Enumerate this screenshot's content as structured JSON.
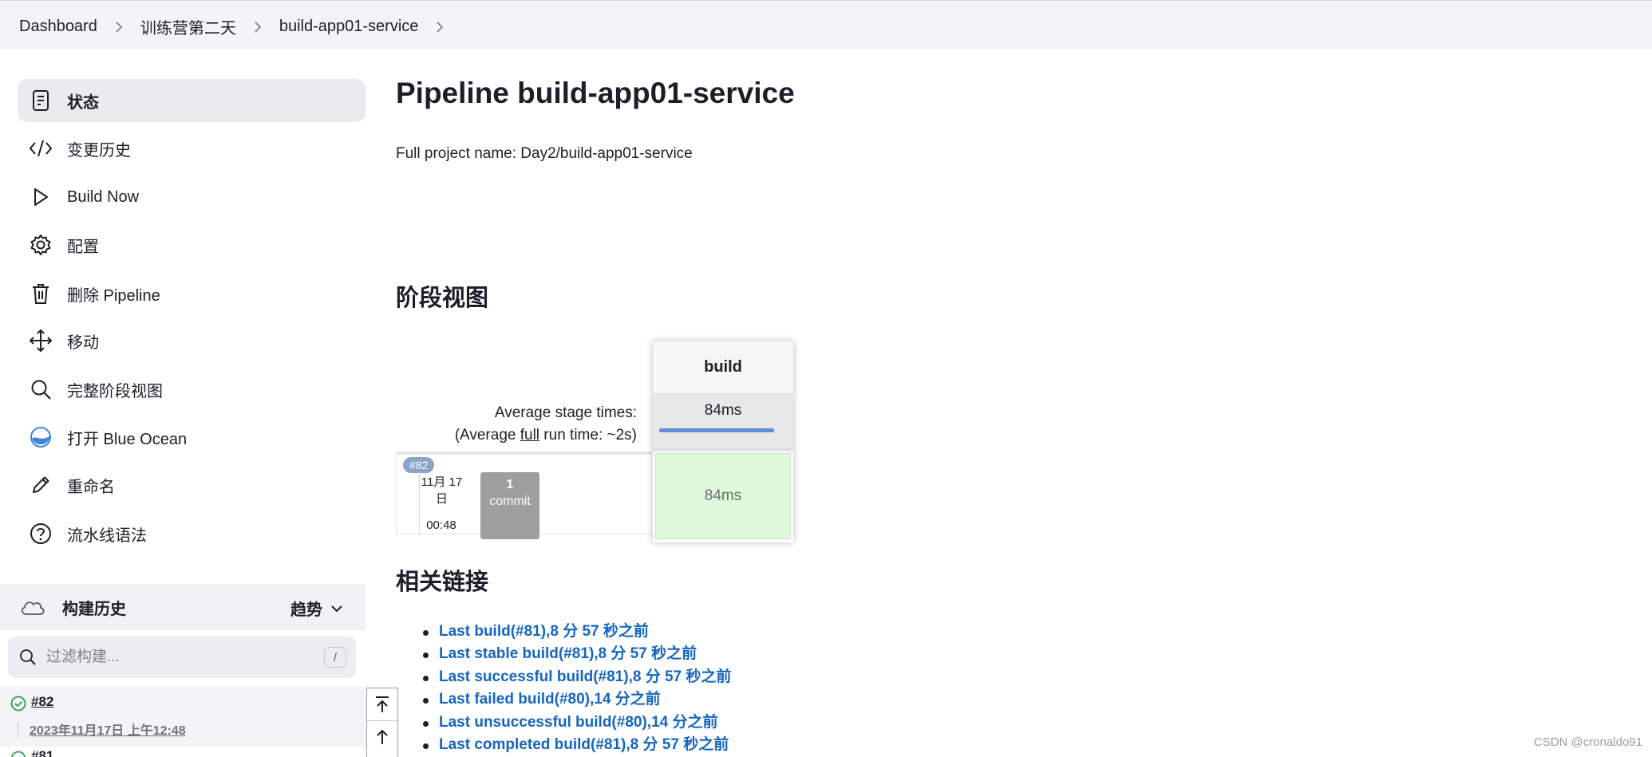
{
  "breadcrumb": [
    "Dashboard",
    "训练营第二天",
    "build-app01-service"
  ],
  "sidebar": {
    "items": [
      {
        "label": "状态",
        "icon": "status-icon",
        "active": true
      },
      {
        "label": "变更历史",
        "icon": "code-icon"
      },
      {
        "label": "Build Now",
        "icon": "play-icon"
      },
      {
        "label": "配置",
        "icon": "gear-icon"
      },
      {
        "label": "删除 Pipeline",
        "icon": "trash-icon"
      },
      {
        "label": "移动",
        "icon": "move-icon"
      },
      {
        "label": "完整阶段视图",
        "icon": "search-icon"
      },
      {
        "label": "打开 Blue Ocean",
        "icon": "blue-ocean-icon"
      },
      {
        "label": "重命名",
        "icon": "pencil-icon"
      },
      {
        "label": "流水线语法",
        "icon": "help-icon"
      }
    ]
  },
  "build_history": {
    "title": "构建历史",
    "trend_label": "趋势",
    "filter_placeholder": "过滤构建...",
    "shortcut_key": "/",
    "builds": [
      {
        "number": "#82",
        "date": "2023年11月17日 上午12:48",
        "status": "success"
      },
      {
        "number": "#81",
        "status": "success"
      }
    ]
  },
  "main": {
    "title": "Pipeline build-app01-service",
    "full_name": "Full project name: Day2/build-app01-service",
    "stage_view_title": "阶段视图",
    "related_links_title": "相关链接"
  },
  "stage_view": {
    "avg_label": "Average stage times:",
    "avg_full_prefix": "(Average ",
    "avg_full_word": "full",
    "avg_full_suffix": " run time: ~2s)",
    "stage_name": "build",
    "stage_avg": "84ms",
    "stage_avg_progress": 0.9,
    "run": {
      "badge": "#82",
      "date_line1": "11月 17",
      "date_line2": "日",
      "time": "00:48",
      "commit_count": "1",
      "commit_label": "commit",
      "duration": "84ms",
      "status": "success"
    }
  },
  "related_links": [
    "Last build(#81),8 分 57 秒之前",
    "Last stable build(#81),8 分 57 秒之前",
    "Last successful build(#81),8 分 57 秒之前",
    "Last failed build(#80),14 分之前",
    "Last unsuccessful build(#80),14 分之前",
    "Last completed build(#81),8 分 57 秒之前"
  ],
  "watermark": "CSDN @cronaldo91",
  "colors": {
    "accent_link": "#1565c0",
    "success_green": "#1ea446",
    "stage_success_bg": "#dff7dd",
    "progress_blue": "#5e8fd6"
  }
}
